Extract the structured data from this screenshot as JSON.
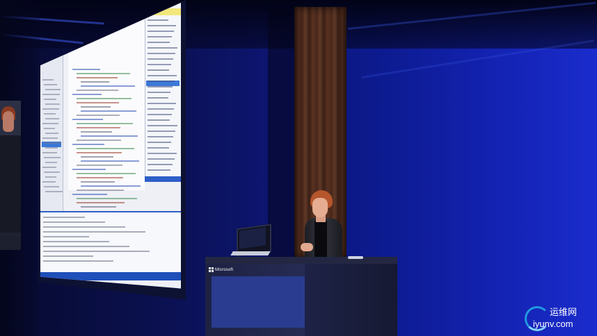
{
  "podium": {
    "brand": "Microsoft"
  },
  "watermark": {
    "name": "运维网",
    "url": "iyunv.com"
  },
  "colors": {
    "stage_blue": "#1322b0",
    "pillar_wood": "#5a3222",
    "ide_accent": "#3b78d8",
    "podium": "#232742"
  }
}
